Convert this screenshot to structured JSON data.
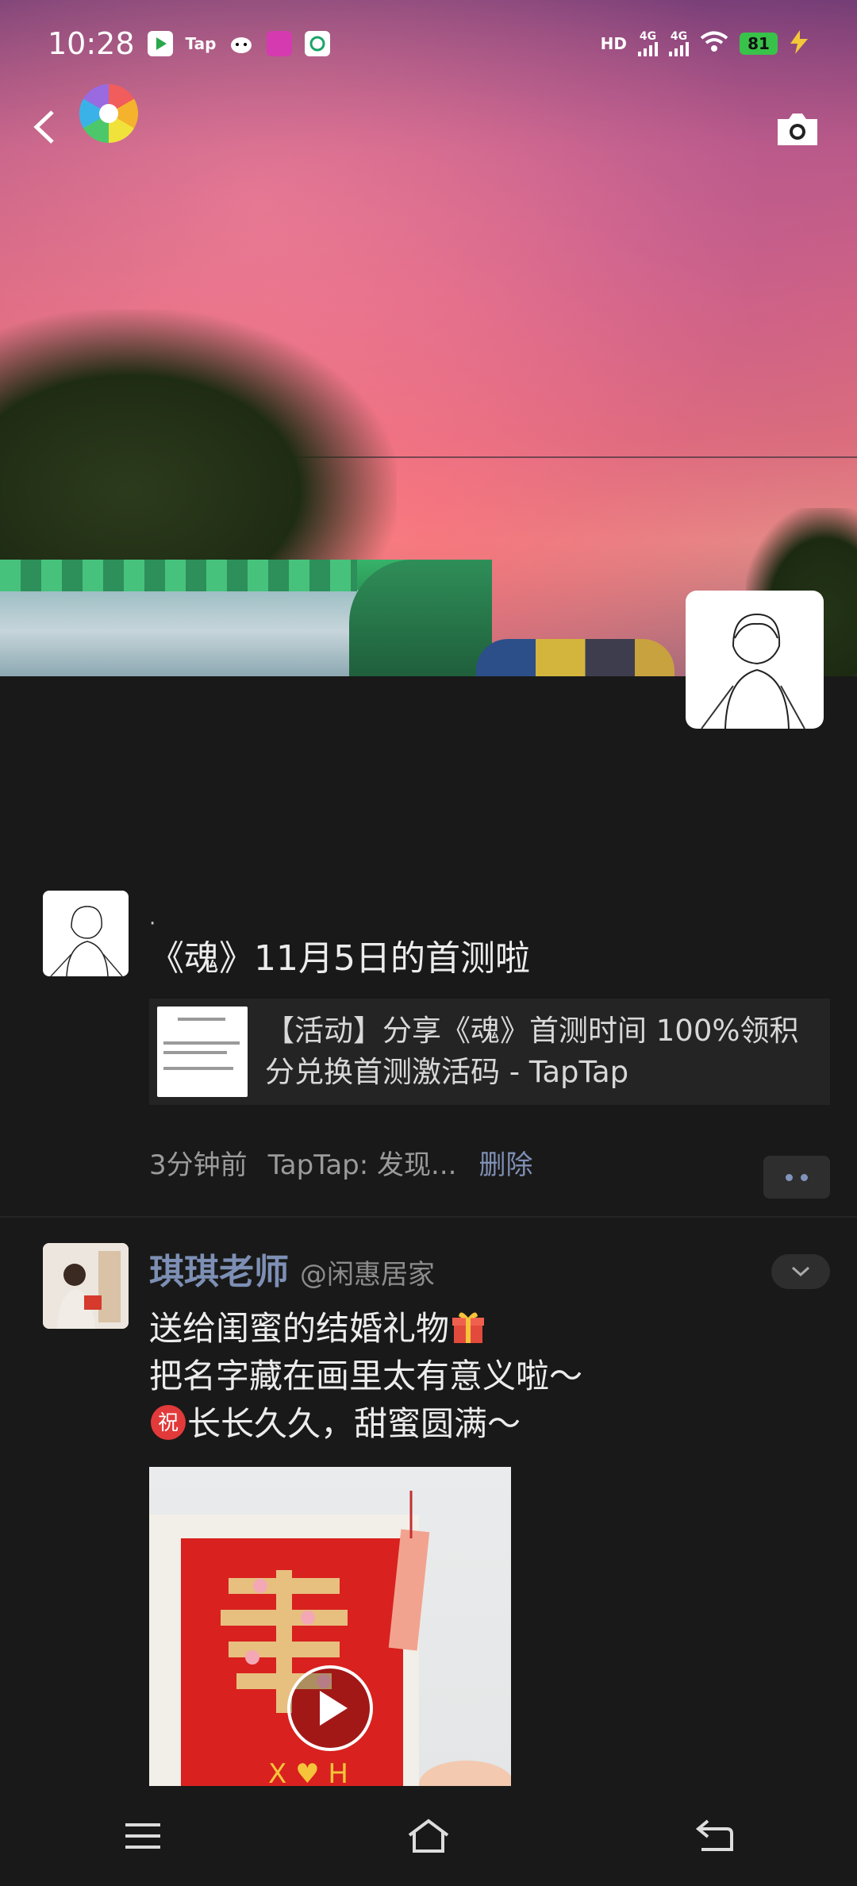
{
  "status_bar": {
    "time": "10:28",
    "app_icons": [
      "video-app-icon",
      "taptap-icon",
      "cat-app-icon",
      "mall-app-icon",
      "mobile-app-icon"
    ],
    "taptap_text": "Tap",
    "network1": "4G",
    "network2": "4G",
    "hd_label": "HD",
    "battery": "81"
  },
  "header": {
    "back_icon": "back-arrow-icon",
    "logo_icon": "moments-logo-icon",
    "camera_icon": "camera-icon"
  },
  "posts": [
    {
      "dot": "·",
      "text": "《魂》11月5日的首测啦",
      "share_text": "【活动】分享《魂》首测时间 100%领积分兑换首测激活码 - TapTap",
      "time": "3分钟前",
      "source": "TapTap: 发现...",
      "delete_label": "删除"
    },
    {
      "name": "琪琪老师",
      "handle": "@闲惠居家",
      "lines": [
        "送给闺蜜的结婚礼物",
        "把名字藏在画里太有意义啦～",
        "长长久久，甜蜜圆满～"
      ]
    }
  ],
  "bottom_nav": {
    "menu_icon": "menu-icon",
    "home_icon": "home-icon",
    "back_icon": "return-icon"
  },
  "colors": {
    "background": "#191919",
    "link": "#7d8fb4",
    "battery": "#39c24a"
  }
}
